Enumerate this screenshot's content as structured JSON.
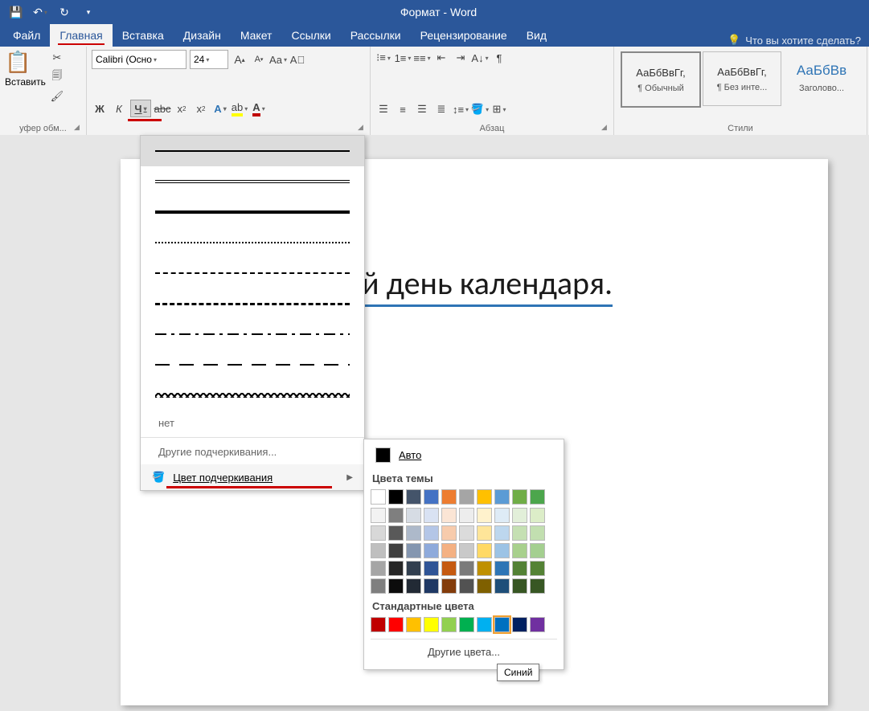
{
  "title": "Формат - Word",
  "tabs": [
    "Файл",
    "Главная",
    "Вставка",
    "Дизайн",
    "Макет",
    "Ссылки",
    "Рассылки",
    "Рецензирование",
    "Вид"
  ],
  "active_tab": 1,
  "tell_me": "Что вы хотите сделать?",
  "clipboard": {
    "paste": "Вставить",
    "label": "уфер обм..."
  },
  "font": {
    "name": "Calibri (Осно",
    "size": "24"
  },
  "paragraph_label": "Абзац",
  "styles_label": "Стили",
  "styles": [
    {
      "preview": "АаБбВвГг,",
      "name": "¶ Обычный",
      "selected": true
    },
    {
      "preview": "АаБбВвГг,",
      "name": "¶ Без инте...",
      "selected": false
    },
    {
      "preview": "АаБбВв",
      "name": "Заголово...",
      "selected": false,
      "color": "#2e74b5"
    }
  ],
  "document_text": "й день календаря.",
  "underline_menu": {
    "none": "нет",
    "more": "Другие подчеркивания...",
    "color": "Цвет подчеркивания"
  },
  "color_flyout": {
    "auto": "Авто",
    "theme_header": "Цвета темы",
    "standard_header": "Стандартные цвета",
    "more": "Другие цвета...",
    "theme_row1": [
      "#ffffff",
      "#000000",
      "#44546a",
      "#4472c4",
      "#ed7d31",
      "#a5a5a5",
      "#ffc000",
      "#5b9bd5",
      "#70ad47",
      "#4ca64c"
    ],
    "theme_shades": [
      [
        "#f2f2f2",
        "#7f7f7f",
        "#d6dce4",
        "#d9e2f3",
        "#fbe5d5",
        "#ededed",
        "#fff2cc",
        "#deebf6",
        "#e2efd9",
        "#dcedc8"
      ],
      [
        "#d8d8d8",
        "#595959",
        "#adb9ca",
        "#b4c6e7",
        "#f7cbac",
        "#dbdbdb",
        "#fee599",
        "#bdd7ee",
        "#c5e0b3",
        "#c2dfb0"
      ],
      [
        "#bfbfbf",
        "#3f3f3f",
        "#8496b0",
        "#8eaadb",
        "#f4b183",
        "#c9c9c9",
        "#ffd965",
        "#9cc3e5",
        "#a8d08d",
        "#a4cf90"
      ],
      [
        "#a5a5a5",
        "#262626",
        "#323f4f",
        "#2f5496",
        "#c55a11",
        "#7b7b7b",
        "#bf9000",
        "#2e75b5",
        "#538135",
        "#548235"
      ],
      [
        "#7f7f7f",
        "#0c0c0c",
        "#222a35",
        "#1f3864",
        "#833c0b",
        "#525252",
        "#7f6000",
        "#1e4e79",
        "#375623",
        "#385724"
      ]
    ],
    "standard": [
      "#c00000",
      "#ff0000",
      "#ffc000",
      "#ffff00",
      "#92d050",
      "#00b050",
      "#00b0f0",
      "#0070c0",
      "#002060",
      "#7030a0"
    ],
    "selected_standard": 7
  },
  "tooltip": "Синий"
}
